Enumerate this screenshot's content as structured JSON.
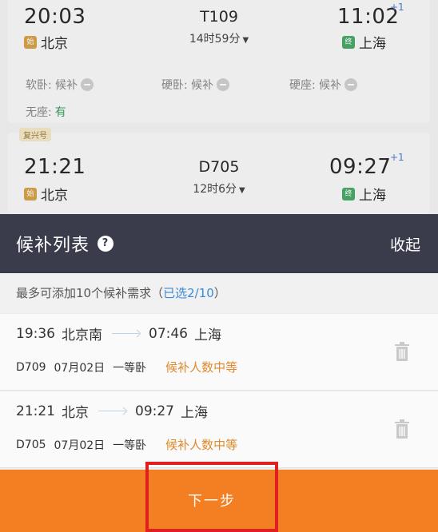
{
  "trains": [
    {
      "dep_time": "20:03",
      "train_no": "T109",
      "duration": "14时59分",
      "arr_time": "11:02",
      "day_offset": "+1",
      "from_badge": "始",
      "from": "北京",
      "to_badge": "终",
      "to": "上海",
      "seats": [
        {
          "label": "软卧: 候补"
        },
        {
          "label": "硬卧: 候补"
        },
        {
          "label": "硬座: 候补"
        }
      ],
      "no_seat_label": "无座:",
      "no_seat_value": "有"
    },
    {
      "tag": "复兴号",
      "dep_time": "21:21",
      "train_no": "D705",
      "duration": "12时6分",
      "arr_time": "09:27",
      "day_offset": "+1",
      "from_badge": "始",
      "from": "北京",
      "to_badge": "终",
      "to": "上海"
    }
  ],
  "panel": {
    "title": "候补列表",
    "help_icon": "?",
    "collapse": "收起",
    "hint_prefix": "最多可添加10个候补需求（",
    "hint_selected": "已选2/10",
    "hint_suffix": "）"
  },
  "selected_items": [
    {
      "dep_time": "19:36",
      "from": "北京南",
      "arr_time": "07:46",
      "to": "上海",
      "train_no": "D709",
      "date": "07月02日",
      "seat": "一等卧",
      "status": "候补人数中等"
    },
    {
      "dep_time": "21:21",
      "from": "北京",
      "arr_time": "09:27",
      "to": "上海",
      "train_no": "D705",
      "date": "07月02日",
      "seat": "一等卧",
      "status": "候补人数中等"
    }
  ],
  "actions": {
    "next_label": "下一步"
  },
  "colors": {
    "header_bg": "#3a3c4c",
    "accent_orange": "#f47e22",
    "status_orange": "#e08a2a",
    "link_blue": "#3a8ad8",
    "highlight_red": "#e01f1f"
  }
}
